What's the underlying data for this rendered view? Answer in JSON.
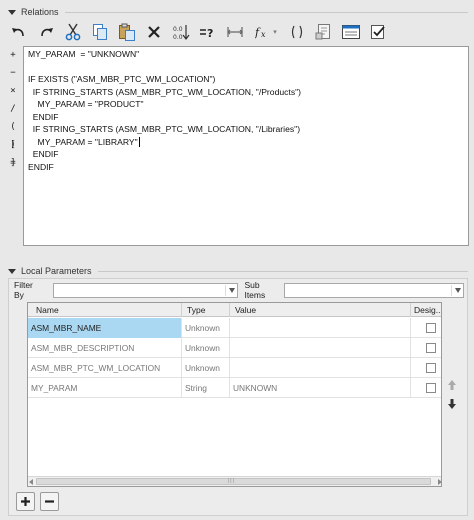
{
  "relations": {
    "header": "Relations",
    "toolbar": [
      {
        "name": "undo-icon"
      },
      {
        "name": "redo-icon"
      },
      {
        "name": "cut-icon"
      },
      {
        "name": "copy-icon"
      },
      {
        "name": "paste-icon"
      },
      {
        "name": "delete-icon"
      },
      {
        "name": "sort-icon"
      },
      {
        "name": "verify-icon"
      },
      {
        "name": "unit-sensitive-icon"
      },
      {
        "name": "function-icon"
      },
      {
        "name": "parentheses-icon"
      },
      {
        "name": "model-parameters-icon"
      },
      {
        "name": "show-values-icon"
      },
      {
        "name": "verify-relations-icon"
      }
    ],
    "operators": [
      "+",
      "−",
      "×",
      "/",
      "( )",
      "[ ]",
      "="
    ],
    "lines": [
      "MY_PARAM  = \"UNKNOWN\"",
      "",
      "IF EXISTS (\"ASM_MBR_PTC_WM_LOCATION\")",
      "  IF STRING_STARTS (ASM_MBR_PTC_WM_LOCATION, \"/Products\")",
      "    MY_PARAM = \"PRODUCT\"",
      "  ENDIF",
      "  IF STRING_STARTS (ASM_MBR_PTC_WM_LOCATION, \"/Libraries\")",
      "    MY_PARAM = \"LIBRARY\"",
      "  ENDIF",
      "ENDIF"
    ]
  },
  "local_parameters": {
    "header": "Local Parameters",
    "filter_label": "Filter By",
    "filter_value": "",
    "sub_items_label": "Sub Items",
    "sub_items_value": "",
    "columns": [
      "Name",
      "Type",
      "Value",
      "Desig..."
    ],
    "rows": [
      {
        "name": "ASM_MBR_NAME",
        "type": "Unknown",
        "value": "",
        "designated": false,
        "selected": true
      },
      {
        "name": "ASM_MBR_DESCRIPTION",
        "type": "Unknown",
        "value": "",
        "designated": false,
        "selected": false
      },
      {
        "name": "ASM_MBR_PTC_WM_LOCATION",
        "type": "Unknown",
        "value": "",
        "designated": false,
        "selected": false
      },
      {
        "name": "MY_PARAM",
        "type": "String",
        "value": "UNKNOWN",
        "designated": false,
        "selected": false
      }
    ],
    "add_icon": "plus-icon",
    "remove_icon": "minus-icon"
  }
}
